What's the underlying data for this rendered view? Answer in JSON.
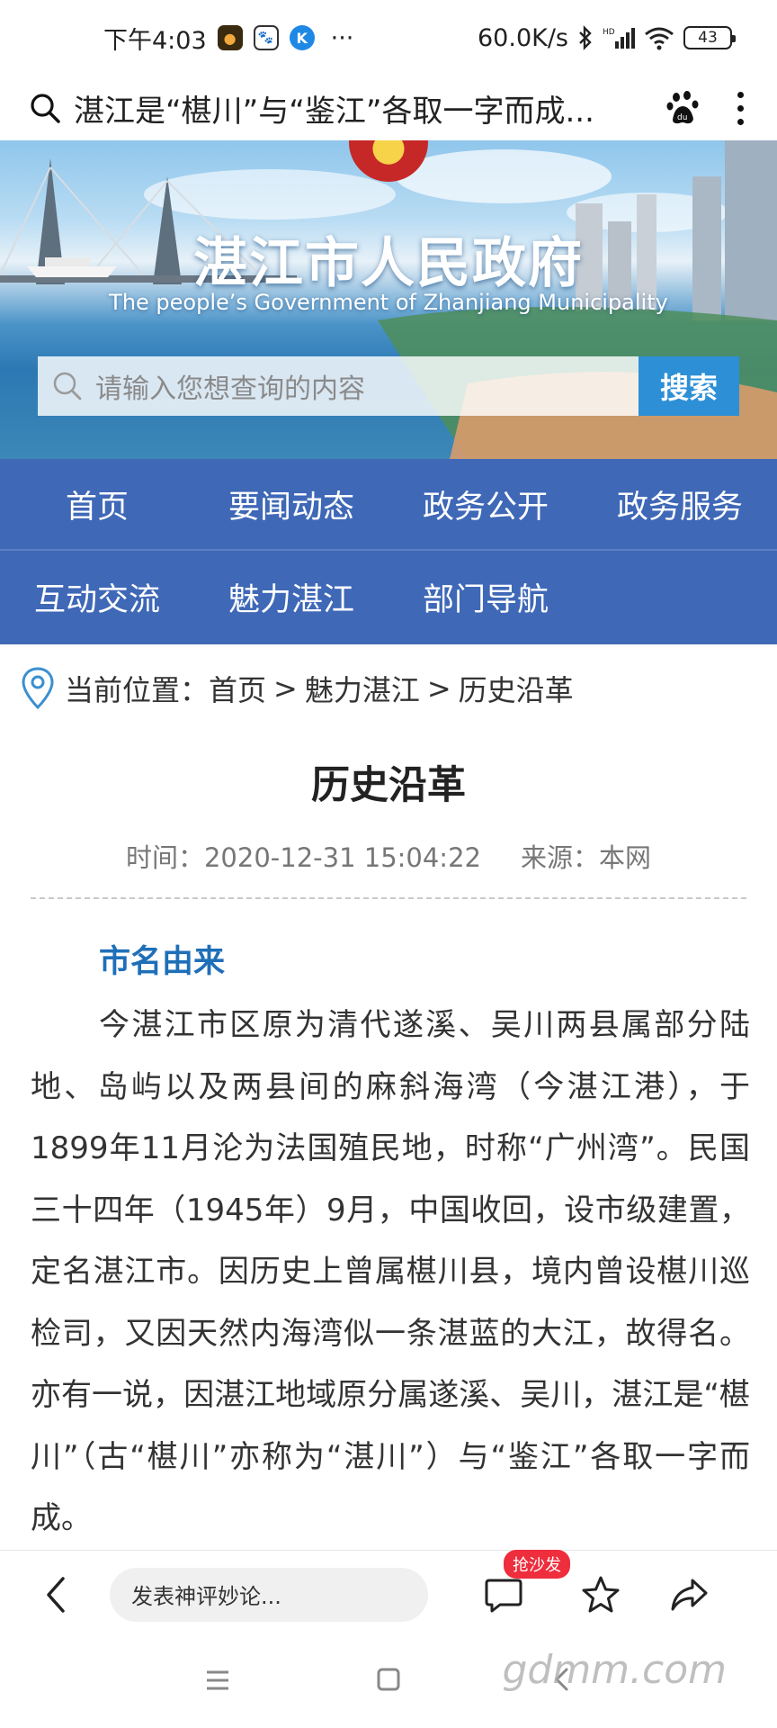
{
  "status_bar": {
    "time": "下午4:03",
    "more": "···",
    "network_speed": "60.0K/s",
    "battery": "43",
    "icons": [
      "app-icon-orange",
      "baidu-paw-icon",
      "k-app-icon",
      "bluetooth-icon",
      "signal-icon",
      "wifi-icon",
      "battery-icon"
    ]
  },
  "top_bar": {
    "search_title": "湛江是“椹川”与“鉴江”各取一字而成..."
  },
  "banner": {
    "title": "湛江市人民政府",
    "subtitle": "The people’s Government of Zhanjiang Municipality",
    "search_placeholder": "请输入您想查询的内容",
    "search_button": "搜索"
  },
  "nav": {
    "row1": [
      "首页",
      "要闻动态",
      "政务公开",
      "政务服务"
    ],
    "row2": [
      "互动交流",
      "魅力湛江",
      "部门导航"
    ]
  },
  "breadcrumb": {
    "prefix": "当前位置：",
    "items": [
      "首页",
      "魅力湛江",
      "历史沿革"
    ],
    "separator": ">"
  },
  "article": {
    "title": "历史沿革",
    "time_label": "时间：2020-12-31 15:04:22",
    "source_label": "来源：本网",
    "section_heading": "市名由来",
    "paragraph": "今湛江市区原为清代遂溪、吴川两县属部分陆地、岛屿以及两县间的麻斜海湾（今湛江港），于1899年11月沦为法国殖民地，时称“广州湾”。民国三十四年（1945年）9月，中国收回，设市级建置，定名湛江市。因历史上曾属椹川县，境内曾设椹川巡检司，又因天然内海湾似一条湛蓝的大江，故得名。亦有一说，因湛江地域原分属遂溪、吴川，湛江是“椹川”（古“椹川”亦称为“湛川”）与“鉴江”各取一字而成。"
  },
  "bottom_bar": {
    "comment_placeholder": "发表神评妙论...",
    "badge": "抢沙发"
  },
  "watermark": "gdmm.com",
  "colors": {
    "nav_bg": "#3f68b7",
    "search_button": "#2d8fd6",
    "section_heading": "#1f6fb8",
    "badge": "#ee2d3d"
  }
}
